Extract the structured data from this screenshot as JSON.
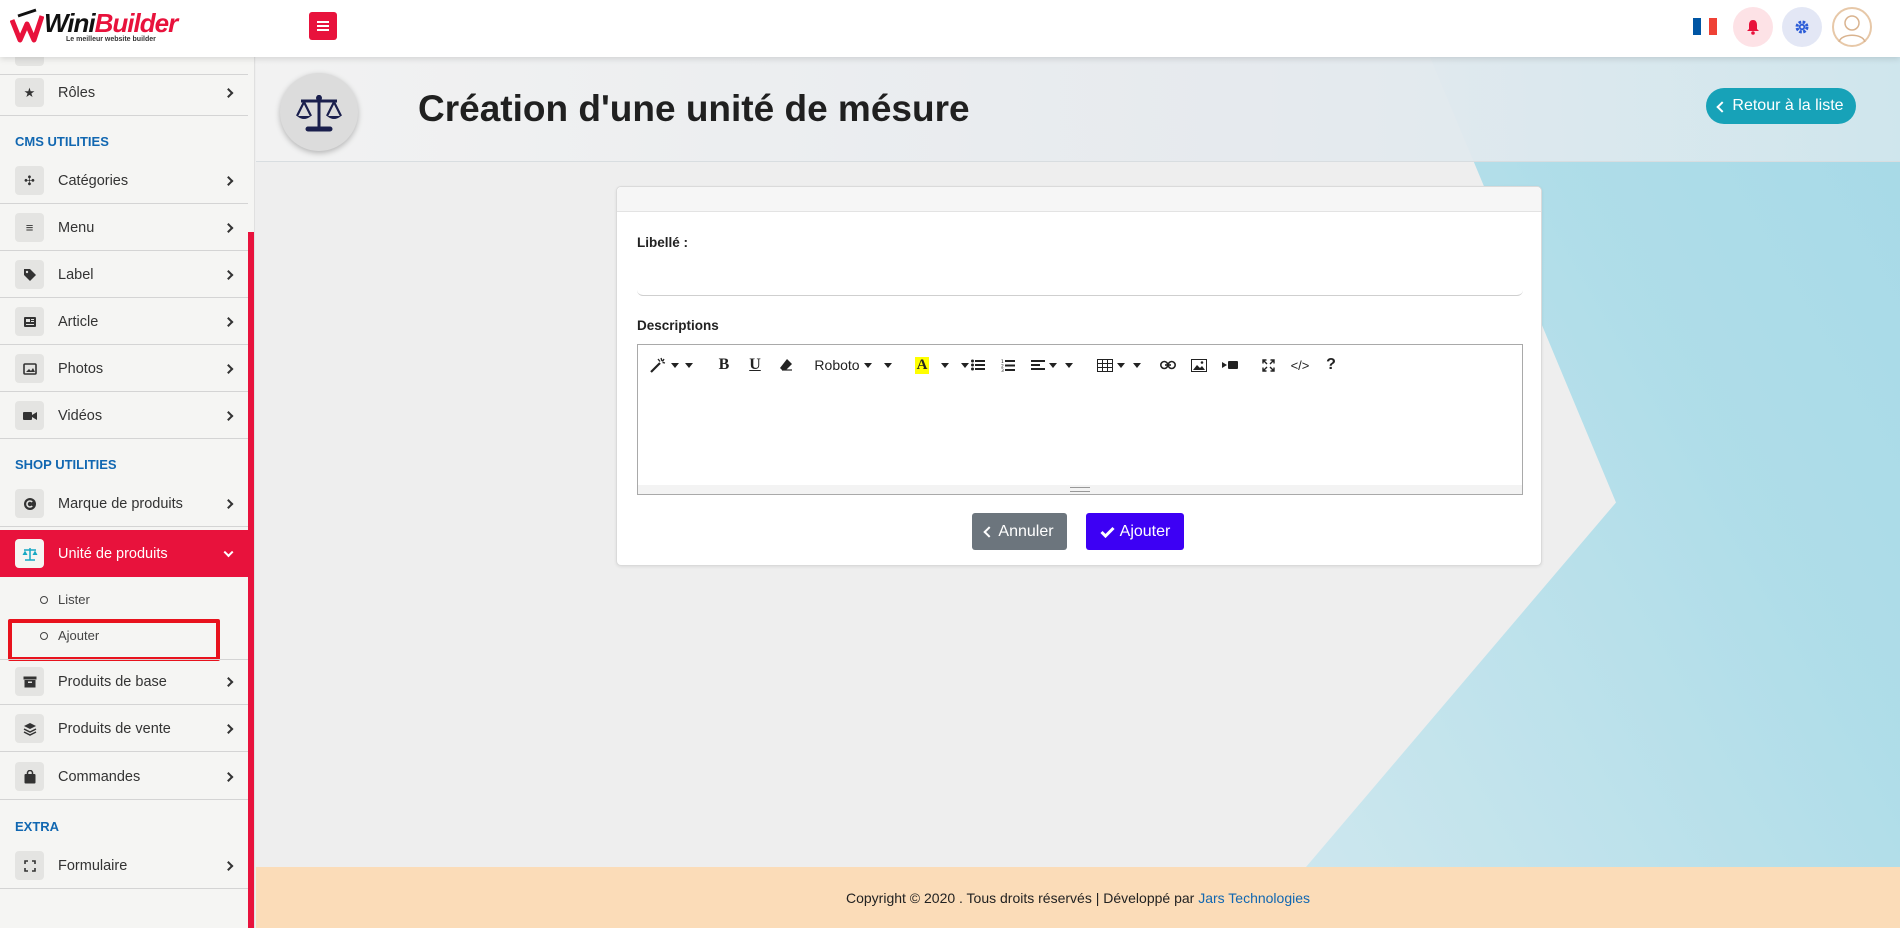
{
  "brand": {
    "name_part1": "Wini",
    "name_part2": "Builder",
    "tagline": "Le meilleur website builder"
  },
  "topbar": {
    "menu_icon": "hamburger-icon",
    "flag_colors": [
      "#0055a4",
      "#ffffff",
      "#ef4135"
    ],
    "bell_icon": "bell-icon",
    "gear_icon": "gear-icon",
    "avatar_icon": "user-avatar-icon"
  },
  "sidebar": {
    "sections": {
      "cms": "CMS UTILITIES",
      "shop": "SHOP UTILITIES",
      "extra": "EXTRA"
    },
    "items": {
      "roles": "Rôles",
      "categories": "Catégories",
      "menu": "Menu",
      "label": "Label",
      "article": "Article",
      "photos": "Photos",
      "videos": "Vidéos",
      "marque": "Marque de produits",
      "unite": "Unité de produits",
      "produits_base": "Produits de base",
      "produits_vente": "Produits de vente",
      "commandes": "Commandes",
      "formulaire": "Formulaire"
    },
    "sub_items": {
      "lister": "Lister",
      "ajouter": "Ajouter"
    },
    "accent_color": "#e8123c"
  },
  "page": {
    "title": "Création d'une unité de mésure",
    "back_button": "Retour à la liste"
  },
  "form": {
    "libelle_label": "Libellé :",
    "libelle_value": "",
    "descriptions_label": "Descriptions",
    "font_name": "Roboto",
    "cancel_button": "Annuler",
    "submit_button": "Ajouter"
  },
  "footer": {
    "text": "Copyright © 2020 . Tous droits réservés | Développé par",
    "link": "Jars Technologies"
  }
}
